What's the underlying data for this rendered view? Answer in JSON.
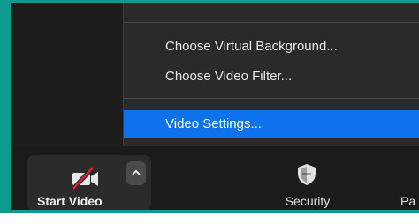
{
  "menu": {
    "items": [
      {
        "label": "Choose Virtual Background..."
      },
      {
        "label": "Choose Video Filter..."
      },
      {
        "label": "Video Settings...",
        "selected": true
      }
    ]
  },
  "toolbar": {
    "start_video": {
      "label": "Start Video",
      "icon": "video-camera-off-icon"
    },
    "video_options": {
      "icon": "chevron-up-icon"
    },
    "security": {
      "label": "Security",
      "icon": "shield-icon"
    },
    "participants": {
      "label": "Pa"
    }
  },
  "colors": {
    "frame": "#0f9a8e",
    "selected": "#0e72ed",
    "muted_slash": "#e02828"
  }
}
